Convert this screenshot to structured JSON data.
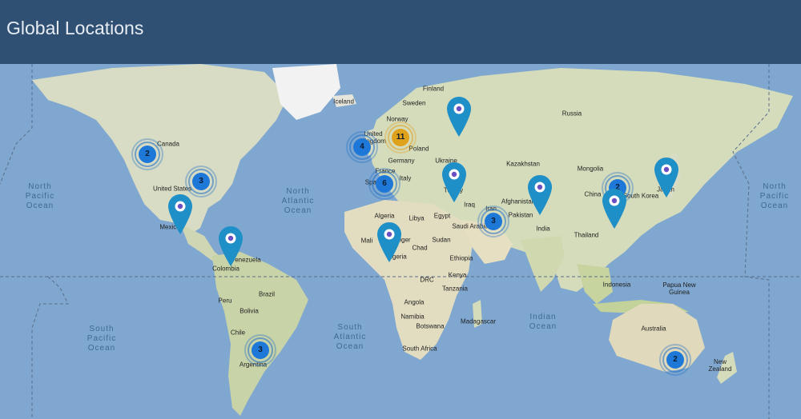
{
  "header": {
    "title": "Global Locations"
  },
  "colors": {
    "header_bg": "#2f4f73",
    "ocean": "#7fa7cf",
    "land": "#d8dcc4",
    "cluster_blue": "#1e78d8",
    "cluster_gold": "#e0a21a",
    "pin": "#1f8fc7"
  },
  "oceans": {
    "north_pacific_left": "North\nPacific\nOcean",
    "north_atlantic": "North\nAtlantic\nOcean",
    "south_pacific": "South\nPacific\nOcean",
    "south_atlantic": "South\nAtlantic\nOcean",
    "indian": "Indian\nOcean",
    "north_pacific_right": "North\nPacific\nOcean"
  },
  "places": {
    "canada": "Canada",
    "united_states": "United States",
    "mexico": "Mexico",
    "venezuela": "Venezuela",
    "colombia": "Colombia",
    "peru": "Peru",
    "brazil": "Brazil",
    "bolivia": "Bolivia",
    "chile": "Chile",
    "argentina": "Argentina",
    "iceland": "Iceland",
    "finland": "Finland",
    "sweden": "Sweden",
    "norway": "Norway",
    "united_kingdom": "United\nKingdom",
    "poland": "Poland",
    "germany": "Germany",
    "ukraine": "Ukraine",
    "france": "France",
    "spain": "Spain",
    "italy": "Italy",
    "turkey": "Turkey",
    "russia": "Russia",
    "kazakhstan": "Kazakhstan",
    "mongolia": "Mongolia",
    "china": "China",
    "south_korea": "South Korea",
    "japan": "Japan",
    "afghanistan": "Afghanistan",
    "pakistan": "Pakistan",
    "iraq": "Iraq",
    "iran": "Iran",
    "saudi_arabia": "Saudi Arabia",
    "india": "India",
    "thailand": "Thailand",
    "algeria": "Algeria",
    "libya": "Libya",
    "egypt": "Egypt",
    "mali": "Mali",
    "niger": "Niger",
    "chad": "Chad",
    "sudan": "Sudan",
    "nigeria": "Nigeria",
    "ethiopia": "Ethiopia",
    "kenya": "Kenya",
    "drc": "DRC",
    "tanzania": "Tanzania",
    "angola": "Angola",
    "namibia": "Namibia",
    "botswana": "Botswana",
    "madagascar": "Madagascar",
    "south_africa": "South Africa",
    "indonesia": "Indonesia",
    "papua_new_guinea": "Papua New\nGuinea",
    "australia": "Australia",
    "new_zealand": "New\nZealand"
  },
  "clusters": {
    "western_canada": "2",
    "eastern_us": "3",
    "united_kingdom": "4",
    "europe": "11",
    "spain": "6",
    "saudi_arabia": "3",
    "east_china": "2",
    "argentina": "3",
    "australia": "2"
  },
  "pins": [
    "mexico-pin",
    "venezuela-pin",
    "nigeria-pin",
    "russia-pin",
    "turkey-pin",
    "india-pin",
    "china-pin",
    "japan-pin"
  ]
}
